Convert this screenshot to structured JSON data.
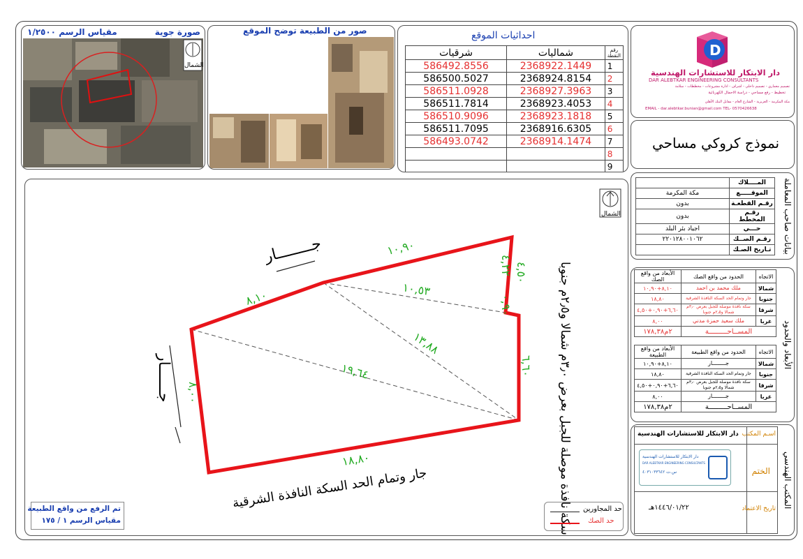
{
  "aerial": {
    "title": "صورة جوية",
    "scale": "مقياس الرسم ١/٢٥٠٠",
    "north": "الشمال"
  },
  "photos": {
    "title": "صور من الطبيعة توضح الموقع"
  },
  "coords": {
    "title": "احداثيات الموقع",
    "col_point": "رقم النقطة",
    "col_north": "شماليات",
    "col_east": "شرقيات",
    "rows": [
      {
        "n": "1",
        "north": "2368922.1449",
        "east": "586492.8556"
      },
      {
        "n": "2",
        "north": "2368924.8154",
        "east": "586500.5027"
      },
      {
        "n": "3",
        "north": "2368927.3963",
        "east": "586511.0928"
      },
      {
        "n": "4",
        "north": "2368923.4053",
        "east": "586511.7814"
      },
      {
        "n": "5",
        "north": "2368923.1818",
        "east": "586510.9096"
      },
      {
        "n": "6",
        "north": "2368916.6305",
        "east": "586511.7095"
      },
      {
        "n": "7",
        "north": "2368914.1474",
        "east": "586493.0742"
      },
      {
        "n": "8",
        "north": "",
        "east": ""
      },
      {
        "n": "9",
        "north": "",
        "east": ""
      }
    ]
  },
  "company": {
    "logo_letter": "D",
    "name_ar": "دار الابتكار للاستشارات الهندسية",
    "name_en": "DAR ALEBTKAR ENGINEERING CONSULTANTS",
    "line1": "تصميم معماري - تصميم داخلي - اشراف - ادارة مشروعات - مخططات - سلامة",
    "line2": "تخطيط - رفع مساحي - دراسة الاحمال الكهربائية",
    "line3": "مكة المكرمة - العزيزية - الشارع العام - مقابل البنك الأهلي",
    "email": "EMAIL - dar.alebtkar.bunian@gmail.com   TEL- 0570426638"
  },
  "doc_title": "نموذج كروكي مساحي",
  "owner": {
    "section_title": "بيانات صاحب المعاملة",
    "rows": [
      {
        "label": "المــــلاك",
        "value": ""
      },
      {
        "label": "الموقـــــع",
        "value": "مكة المكرمة"
      },
      {
        "label": "رقـم القطعـة",
        "value": "بدون"
      },
      {
        "label": "رقـم المخطط",
        "value": "بدون"
      },
      {
        "label": "حـــي",
        "value": "اجياد بئر البلد"
      },
      {
        "label": "رقـم الصــك",
        "value": "٢٢٠١٢٨٠٠١٠٦٢"
      },
      {
        "label": "تـاريخ الصـك",
        "value": ""
      }
    ]
  },
  "boundaries": {
    "section_title": "الأبعاد والحدود",
    "deed": {
      "h_dir": "الاتجاه",
      "h_bound": "الحدود من واقع الصك",
      "h_dim": "الأبعاد من واقع الصك",
      "rows": [
        {
          "dir": "شمالا",
          "bound": "ملك محمد بن احمد",
          "dim": "٨,١٠+١٠,٩٠"
        },
        {
          "dir": "جنوبا",
          "bound": "جار وتمام الحد السكة النافذة الشرقية",
          "dim": "١٨,٨٠"
        },
        {
          "dir": "شرقا",
          "bound": "سكة نافذة موصلة للجبل بعرض ٣٫٠م شمالا و٢٫٥م جنوبا",
          "dim": "٦,٦٠+٠,٩٠+٤,٥٠"
        },
        {
          "dir": "غربا",
          "bound": "ملك سعيد حمزة مدني",
          "dim": "٨,٠٠"
        }
      ],
      "area_label": "المســاحـــــــــة",
      "area_value": "٢م١٧٨,٣٨"
    },
    "nature": {
      "h_dir": "الاتجاه",
      "h_bound": "الحدود من واقع الطبيعة",
      "h_dim": "الأبعاد من واقع الطبيعة",
      "rows": [
        {
          "dir": "شمالا",
          "bound": "جــــــــار",
          "dim": "٨,١٠+١٠,٩٠"
        },
        {
          "dir": "جنوبا",
          "bound": "جار وتمام الحد السكة النافذة الشرقية",
          "dim": "١٨,٨٠"
        },
        {
          "dir": "شرقا",
          "bound": "سكة نافذة موصلة للجبل بعرض ٣٫٠م شمالا و٢٫٥م جنوبا",
          "dim": "٦,٦٠+٠,٩٠+٤,٥٠"
        },
        {
          "dir": "غربا",
          "bound": "جــــــــار",
          "dim": "٨,٠٠"
        }
      ],
      "area_label": "المســاحـــــــــة",
      "area_value": "٢م١٧٨,٣٨"
    }
  },
  "office": {
    "section_title": "المكتب الهندسي",
    "name_label": "اسـم المكتب",
    "name_value": "دار الابتكار للاستشارات الهندسية",
    "stamp_label": "الختم",
    "stamp_text": "دار الابتكار للاستشارات الهندسية",
    "stamp_en": "DAR ALEBTKAR ENGINEERING CONSULTANTS",
    "stamp_num": "س.ت ٤٠٣١٠٣٣٦٤٢",
    "date_label": "تاريخ الاعتماد",
    "date_value": "١٤٤٦/٠١/٢٢هـ"
  },
  "plan": {
    "north": "الشمال",
    "label_north": "جــــــــار",
    "label_west": "جــــــار",
    "label_south": "جار وتمام الحد السكة النافذة الشرقية",
    "label_east": "سكة نافذة موصلة للجبل بعرض ٣٫٠م شمالا و٢٫٥م جنوبا",
    "dim_nw": "٨,١٠",
    "dim_ne": "١٠,٩٠",
    "dim_e1": "٤,٥٠",
    "dim_e2": "٠,٩٠",
    "dim_e3": "٦,٦٠",
    "dim_s": "١٨,٨٠",
    "dim_w": "٨,٠٠",
    "diag1": "١٠,٥٣",
    "diag2": "١٣,٨٨",
    "diag3": "١٩,٦٤",
    "diag4": "٤,٢٢",
    "survey_note": "تم الرفع من واقع الطبيعة",
    "survey_scale": "مقياس الرسم ١ / ١٧٥",
    "legend_neighbors": "حد المجاورين",
    "legend_deed": "حد الصك"
  },
  "colors": {
    "boundary": "#e8141a",
    "dims": "#22aa22",
    "accent_blue": "#1a3fb0"
  }
}
